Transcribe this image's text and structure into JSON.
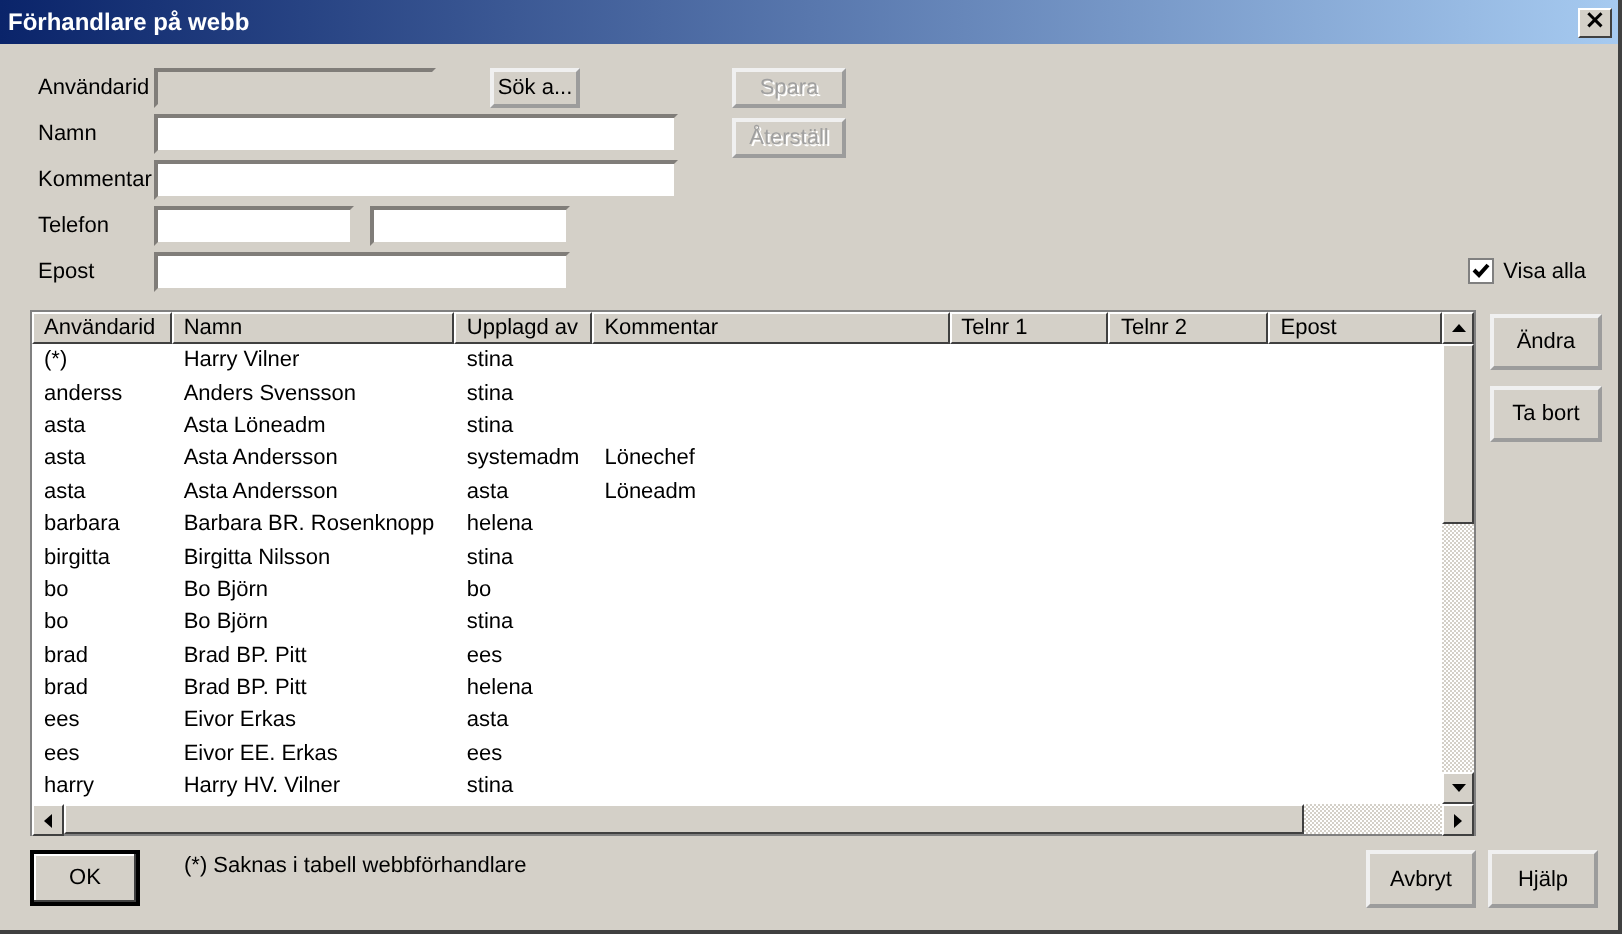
{
  "window": {
    "title": "Förhandlare på webb",
    "close": "×"
  },
  "form": {
    "fields": [
      {
        "label": "Användarid",
        "kind": "single",
        "disabled": true
      },
      {
        "label": "Namn",
        "kind": "single",
        "disabled": false
      },
      {
        "label": "Kommentar",
        "kind": "single",
        "disabled": false
      },
      {
        "label": "Telefon",
        "kind": "double",
        "disabled": false
      },
      {
        "label": "Epost",
        "kind": "single",
        "disabled": false
      }
    ],
    "search_button": "Sök a...",
    "side_buttons": [
      {
        "label": "Spara",
        "disabled": true
      },
      {
        "label": "Återställ",
        "disabled": true
      }
    ],
    "show_all": {
      "label": "Visa alla",
      "checked": true
    }
  },
  "table": {
    "columns": [
      "Användarid",
      "Namn",
      "Upplagd av",
      "Kommentar",
      "Telnr 1",
      "Telnr 2",
      "Epost"
    ],
    "rows": [
      [
        "(*)",
        "Harry Vilner",
        "stina",
        "",
        "",
        "",
        ""
      ],
      [
        "anderss",
        "Anders Svensson",
        "stina",
        "",
        "",
        "",
        ""
      ],
      [
        "asta",
        "Asta Löneadm",
        "stina",
        "",
        "",
        "",
        ""
      ],
      [
        "asta",
        "Asta Andersson",
        "systemadm",
        "Lönechef",
        "",
        "",
        ""
      ],
      [
        "asta",
        "Asta Andersson",
        "asta",
        "Löneadm",
        "",
        "",
        ""
      ],
      [
        "barbara",
        "Barbara BR. Rosenknopp",
        "helena",
        "",
        "",
        "",
        ""
      ],
      [
        "birgitta",
        "Birgitta Nilsson",
        "stina",
        "",
        "",
        "",
        ""
      ],
      [
        "bo",
        "Bo Björn",
        "bo",
        "",
        "",
        "",
        ""
      ],
      [
        "bo",
        "Bo Björn",
        "stina",
        "",
        "",
        "",
        ""
      ],
      [
        "brad",
        "Brad BP. Pitt",
        "ees",
        "",
        "",
        "",
        ""
      ],
      [
        "brad",
        "Brad BP. Pitt",
        "helena",
        "",
        "",
        "",
        ""
      ],
      [
        "ees",
        "Eivor Erkas",
        "asta",
        "",
        "",
        "",
        ""
      ],
      [
        "ees",
        "Eivor EE. Erkas",
        "ees",
        "",
        "",
        "",
        ""
      ],
      [
        "harry",
        "Harry HV. Vilner",
        "stina",
        "",
        "",
        "",
        ""
      ]
    ]
  },
  "row_buttons": [
    "Ändra",
    "Ta bort"
  ],
  "footer": {
    "ok": "OK",
    "note": "(*) Saknas i tabell webbförhandlare",
    "buttons": [
      "Avbryt",
      "Hjälp"
    ]
  }
}
